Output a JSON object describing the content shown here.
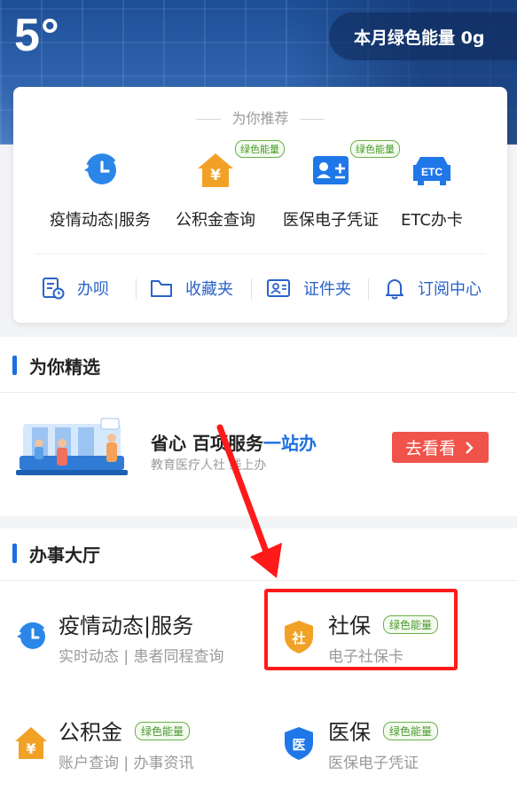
{
  "header": {
    "temperature": "5°",
    "green_energy_label": "本月绿色能量 0g"
  },
  "recommend": {
    "title": "为你推荐",
    "green_tag": "绿色能量",
    "services": [
      {
        "label": "疫情动态|服务",
        "icon": "clock-refresh-icon",
        "green": false
      },
      {
        "label": "公积金查询",
        "icon": "house-yen-icon",
        "green": true
      },
      {
        "label": "医保电子凭证",
        "icon": "id-card-plus-icon",
        "green": true
      },
      {
        "label": "ETC办卡",
        "icon": "etc-car-icon",
        "green": false
      }
    ],
    "quick": [
      {
        "label": "办呗",
        "icon": "document-clock-icon"
      },
      {
        "label": "收藏夹",
        "icon": "folder-icon"
      },
      {
        "label": "证件夹",
        "icon": "id-card-icon"
      },
      {
        "label": "订阅中心",
        "icon": "bell-icon"
      }
    ]
  },
  "featured": {
    "title": "为你精选",
    "promo": {
      "title_plain": "省心 百项服务",
      "title_highlight": "一站办",
      "subtitle": "教育医疗人社 线上办",
      "button": "去看看"
    }
  },
  "hall": {
    "title": "办事大厅",
    "green_tag": "绿色能量",
    "items": [
      {
        "title": "疫情动态|服务",
        "subtitle": "实时动态 | 患者同程查询"
      },
      {
        "title": "社保",
        "subtitle": "电子社保卡",
        "icon_text": "社"
      },
      {
        "title": "公积金",
        "subtitle": "账户查询 | 办事资讯",
        "icon_text": "¥"
      },
      {
        "title": "医保",
        "subtitle": "医保电子凭证",
        "icon_text": "医"
      }
    ]
  },
  "colors": {
    "brand_blue": "#1b6fe0",
    "orange": "#f2a127",
    "red_button": "#f0534a",
    "highlight_red": "#ff1a1a",
    "green_tag": "#4a9a2e"
  }
}
